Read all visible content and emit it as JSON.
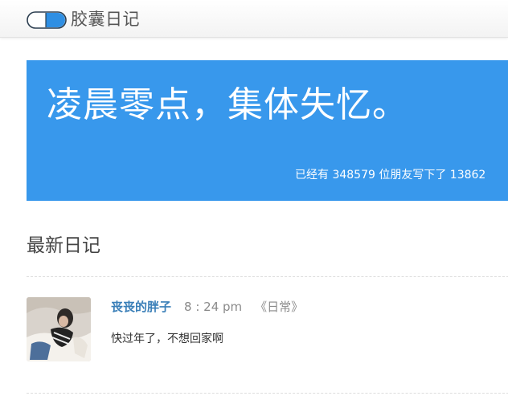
{
  "header": {
    "brand": "胶囊日记",
    "logo_icon": "capsule-icon"
  },
  "hero": {
    "title": "凌晨零点，集体失忆。",
    "stats": "已经有 348579 位朋友写下了 13862",
    "background_color": "#3898ec"
  },
  "section": {
    "title": "最新日记"
  },
  "entries": [
    {
      "author": "丧丧的胖子",
      "time": "8 : 24 pm",
      "category": "《日常》",
      "content": "快过年了，不想回家啊",
      "author_color": "#3a7fb8"
    }
  ]
}
